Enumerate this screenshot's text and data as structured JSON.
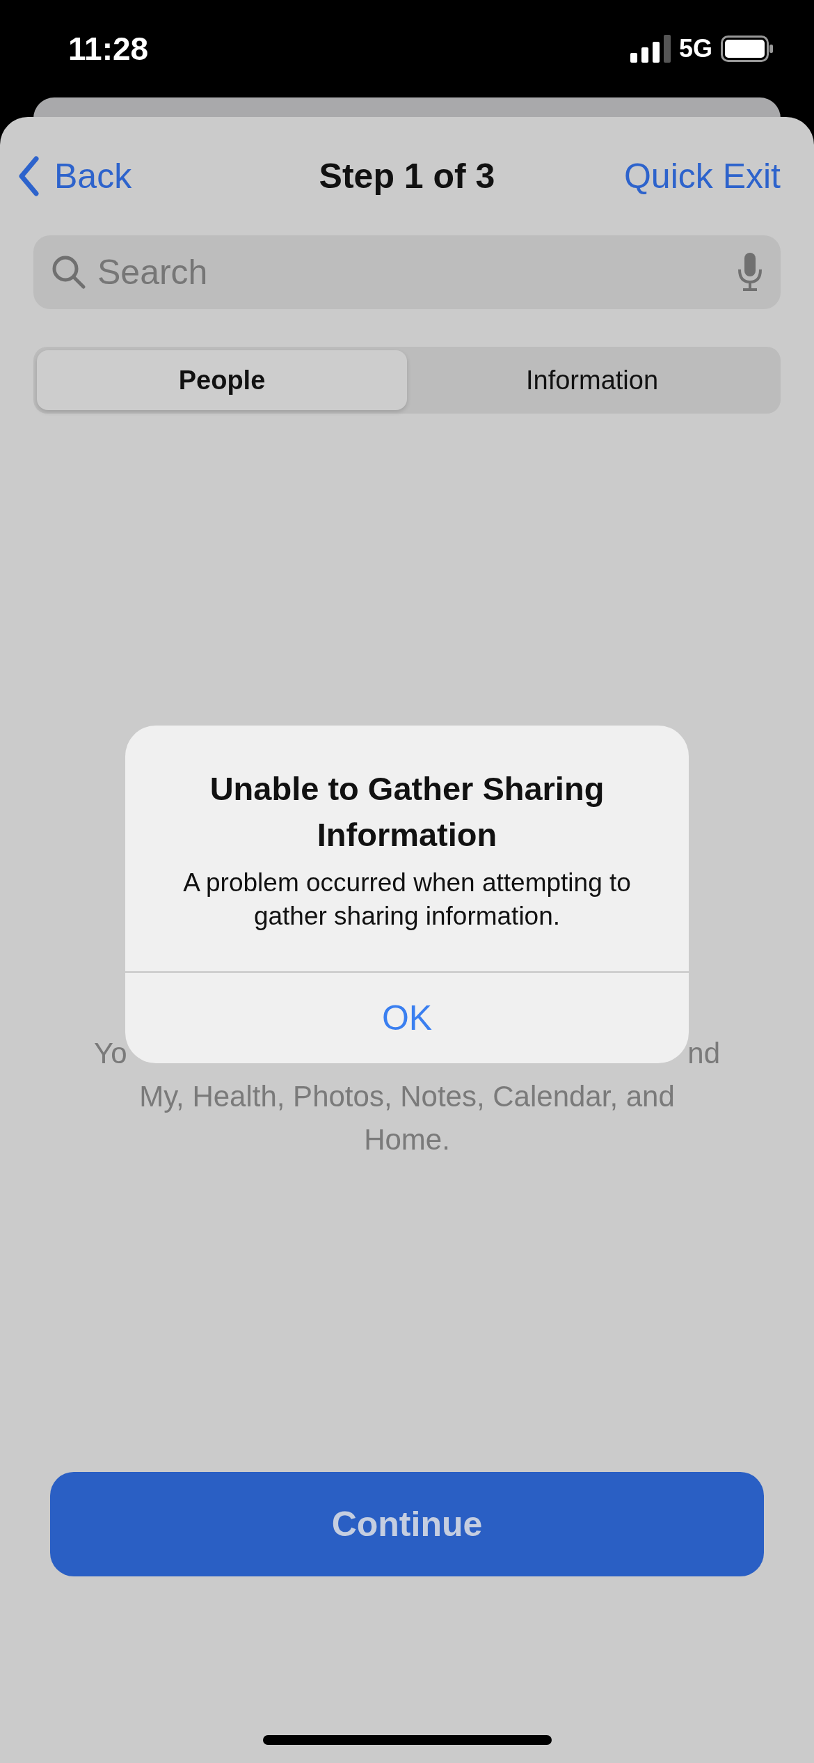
{
  "status_bar": {
    "time": "11:28",
    "network": "5G"
  },
  "nav": {
    "back": "Back",
    "title": "Step 1 of 3",
    "action": "Quick Exit"
  },
  "search": {
    "placeholder": "Search"
  },
  "segments": [
    {
      "label": "People",
      "selected": true
    },
    {
      "label": "Information",
      "selected": false
    }
  ],
  "description": {
    "partial_line_start": "Yo",
    "partial_line_end": "nd",
    "lines": [
      "My, Health, Photos, Notes, Calendar, and",
      "Home."
    ]
  },
  "alert": {
    "title": "Unable to Gather Sharing Information",
    "message": "A problem occurred when attempting to gather sharing information.",
    "button": "OK"
  },
  "primary_button": {
    "label": "Continue"
  }
}
